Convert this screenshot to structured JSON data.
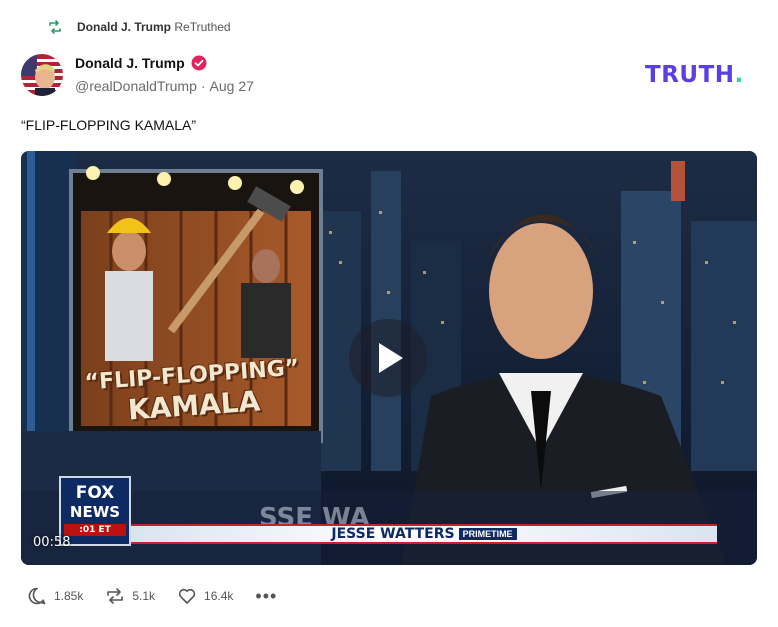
{
  "retruth": {
    "icon": "retruth-icon",
    "name": "Donald J. Trump",
    "suffix": "ReTruthed"
  },
  "post": {
    "author_name": "Donald J. Trump",
    "verified_icon": "verified-badge-icon",
    "handle": "@realDonaldTrump",
    "separator": "·",
    "date": "Aug 27",
    "text": "“FLIP-FLOPPING KAMALA”"
  },
  "brand": {
    "logo_text": "TRUTH",
    "logo_dot": ".",
    "color": "#5b3fe0",
    "dot_color": "#34d399"
  },
  "video": {
    "duration": "00:58",
    "play_icon": "play-icon",
    "promo_line1": "“FLIP-FLOPPING”",
    "promo_line2": "KAMALA",
    "network_line1": "FOX",
    "network_line2": "NEWS",
    "network_time": ":01 ET",
    "chyron_host": "JESSE WATTERS",
    "chyron_show": "PRIMETIME"
  },
  "actions": {
    "replies": {
      "icon": "reply-icon",
      "count": "1.85k"
    },
    "retruths": {
      "icon": "retruth-icon",
      "count": "5.1k"
    },
    "likes": {
      "icon": "heart-icon",
      "count": "16.4k"
    },
    "more": {
      "icon": "more-icon",
      "label": "•••"
    }
  }
}
